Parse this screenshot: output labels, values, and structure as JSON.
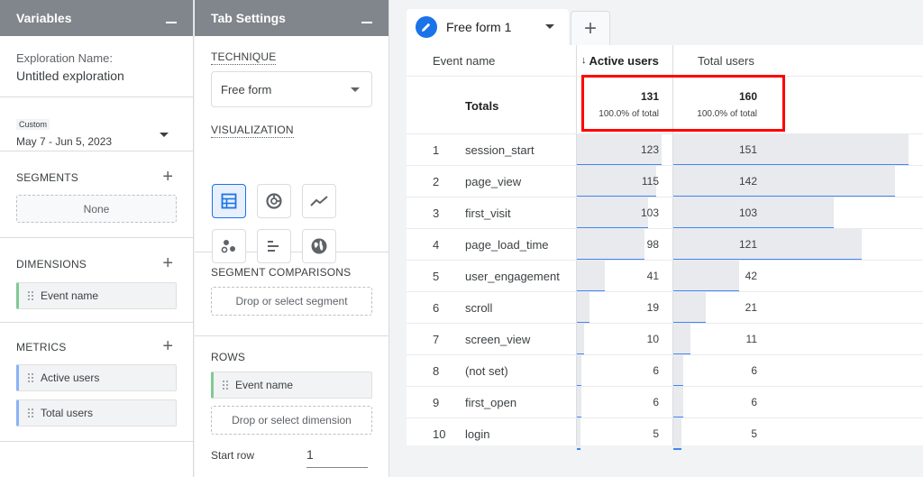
{
  "variables": {
    "title": "Variables",
    "exploration_label": "Exploration Name:",
    "exploration_name": "Untitled exploration",
    "date_badge": "Custom",
    "date_range": "May 7 - Jun 5, 2023",
    "segments_title": "SEGMENTS",
    "segments_none": "None",
    "dimensions_title": "DIMENSIONS",
    "dimensions": [
      "Event name"
    ],
    "metrics_title": "METRICS",
    "metrics": [
      "Active users",
      "Total users"
    ]
  },
  "tab_settings": {
    "title": "Tab Settings",
    "technique_title": "TECHNIQUE",
    "technique_value": "Free form",
    "visualization_title": "VISUALIZATION",
    "visualization_icons": [
      "table-icon",
      "donut-chart-icon",
      "line-chart-icon",
      "scatter-plot-icon",
      "bar-chart-icon",
      "globe-icon"
    ],
    "segment_comparisons_title": "SEGMENT COMPARISONS",
    "segment_drop": "Drop or select segment",
    "rows_title": "ROWS",
    "rows_chip": "Event name",
    "rows_drop": "Drop or select dimension",
    "start_row_label": "Start row",
    "start_row_value": "1"
  },
  "tabs": {
    "active_label": "Free form 1",
    "add_label": "+"
  },
  "table": {
    "col_event": "Event name",
    "col_active": "Active users",
    "col_active_sort": "↓",
    "col_total": "Total users",
    "totals_label": "Totals",
    "totals_active": "131",
    "totals_active_pct": "100.0% of total",
    "totals_total": "160",
    "totals_total_pct": "100.0% of total",
    "rows": [
      {
        "n": "1",
        "name": "session_start",
        "active": "123",
        "total": "151",
        "active_frac": 0.939,
        "total_frac": 0.944
      },
      {
        "n": "2",
        "name": "page_view",
        "active": "115",
        "total": "142",
        "active_frac": 0.878,
        "total_frac": 0.888
      },
      {
        "n": "3",
        "name": "first_visit",
        "active": "103",
        "total": "103",
        "active_frac": 0.786,
        "total_frac": 0.644
      },
      {
        "n": "4",
        "name": "page_load_time",
        "active": "98",
        "total": "121",
        "active_frac": 0.748,
        "total_frac": 0.756
      },
      {
        "n": "5",
        "name": "user_engagement",
        "active": "41",
        "total": "42",
        "active_frac": 0.313,
        "total_frac": 0.263
      },
      {
        "n": "6",
        "name": "scroll",
        "active": "19",
        "total": "21",
        "active_frac": 0.145,
        "total_frac": 0.131
      },
      {
        "n": "7",
        "name": "screen_view",
        "active": "10",
        "total": "11",
        "active_frac": 0.076,
        "total_frac": 0.069
      },
      {
        "n": "8",
        "name": "(not set)",
        "active": "6",
        "total": "6",
        "active_frac": 0.046,
        "total_frac": 0.038
      },
      {
        "n": "9",
        "name": "first_open",
        "active": "6",
        "total": "6",
        "active_frac": 0.046,
        "total_frac": 0.038
      },
      {
        "n": "10",
        "name": "login",
        "active": "5",
        "total": "5",
        "active_frac": 0.038,
        "total_frac": 0.031
      }
    ]
  },
  "colors": {
    "accent": "#1a73e8",
    "bar_line": "#4285f4",
    "bar_fill": "#e8eaed",
    "highlight": "#ff0000",
    "header_bg": "#80868b"
  }
}
